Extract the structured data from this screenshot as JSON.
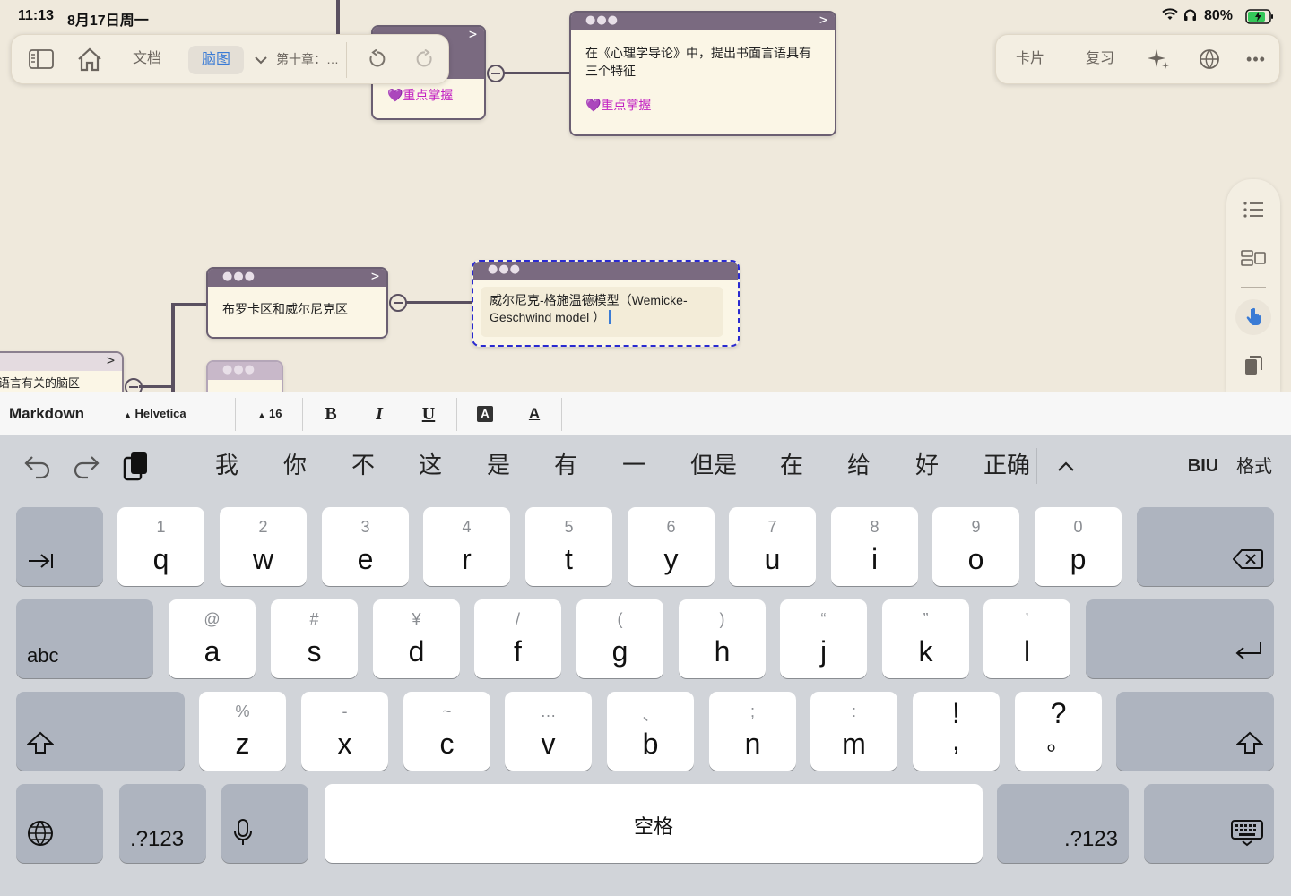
{
  "status": {
    "time": "11:13",
    "date": "8月17日周一",
    "battery": "80%"
  },
  "toolbar_left": {
    "docs_label": "文档",
    "mindmap_label": "脑图",
    "chapter_label": "第十章：…"
  },
  "toolbar_right": {
    "cards_label": "卡片",
    "review_label": "复习"
  },
  "nodes": {
    "top_left_tag": "💜重点掌握",
    "top_right_text": "在《心理学导论》中，提出书面言语具有三个特征",
    "top_right_tag": "💜重点掌握",
    "broca": "布罗卡区和威尔尼克区",
    "wernicke_model": "威尔尼克-格施温德模型（Wemicke-Geschwind model ）",
    "left_partial": "语言有关的脑区"
  },
  "formatbar": {
    "mode": "Markdown",
    "font": "Helvetica",
    "size": "16",
    "bold": "B",
    "italic": "I",
    "underline": "U",
    "bg_color": "A",
    "text_color": "A"
  },
  "suggestions": [
    "我",
    "你",
    "不",
    "这",
    "是",
    "有",
    "一",
    "但是",
    "在",
    "给",
    "好",
    "正确"
  ],
  "kb_toolbar": {
    "biu": "BIU",
    "format": "格式"
  },
  "keys": {
    "row1": [
      {
        "main": "q",
        "sub": "1"
      },
      {
        "main": "w",
        "sub": "2"
      },
      {
        "main": "e",
        "sub": "3"
      },
      {
        "main": "r",
        "sub": "4"
      },
      {
        "main": "t",
        "sub": "5"
      },
      {
        "main": "y",
        "sub": "6"
      },
      {
        "main": "u",
        "sub": "7"
      },
      {
        "main": "i",
        "sub": "8"
      },
      {
        "main": "o",
        "sub": "9"
      },
      {
        "main": "p",
        "sub": "0"
      }
    ],
    "row2": [
      {
        "main": "a",
        "sub": "@"
      },
      {
        "main": "s",
        "sub": "#"
      },
      {
        "main": "d",
        "sub": "¥"
      },
      {
        "main": "f",
        "sub": "/"
      },
      {
        "main": "g",
        "sub": "("
      },
      {
        "main": "h",
        "sub": ")"
      },
      {
        "main": "j",
        "sub": "“"
      },
      {
        "main": "k",
        "sub": "”"
      },
      {
        "main": "l",
        "sub": "’"
      }
    ],
    "row3": [
      {
        "main": "z",
        "sub": "%"
      },
      {
        "main": "x",
        "sub": "-"
      },
      {
        "main": "c",
        "sub": "~"
      },
      {
        "main": "v",
        "sub": "…"
      },
      {
        "main": "b",
        "sub": "、"
      },
      {
        "main": "n",
        "sub": ";"
      },
      {
        "main": "m",
        "sub": ":"
      },
      {
        "main": ",",
        "sub": "!"
      },
      {
        "main": "。",
        "sub": "?"
      }
    ],
    "abc": "abc",
    "num_left": ".?123",
    "num_right": ".?123",
    "space": "空格"
  },
  "icons": {
    "sidebar": "sidebar-icon",
    "home": "home-icon",
    "undo": "undo-icon",
    "redo": "redo-icon",
    "sparkle": "sparkle-icon",
    "web": "web-icon",
    "more": "more-icon"
  },
  "colors": {
    "canvas": "#efe9dc",
    "node_bar": "#7a6a80",
    "node_bg": "#fbf6e6",
    "tag_pink": "#c21fc2",
    "accent_blue": "#3a7bd5",
    "selected_border": "#2a2ad0"
  }
}
